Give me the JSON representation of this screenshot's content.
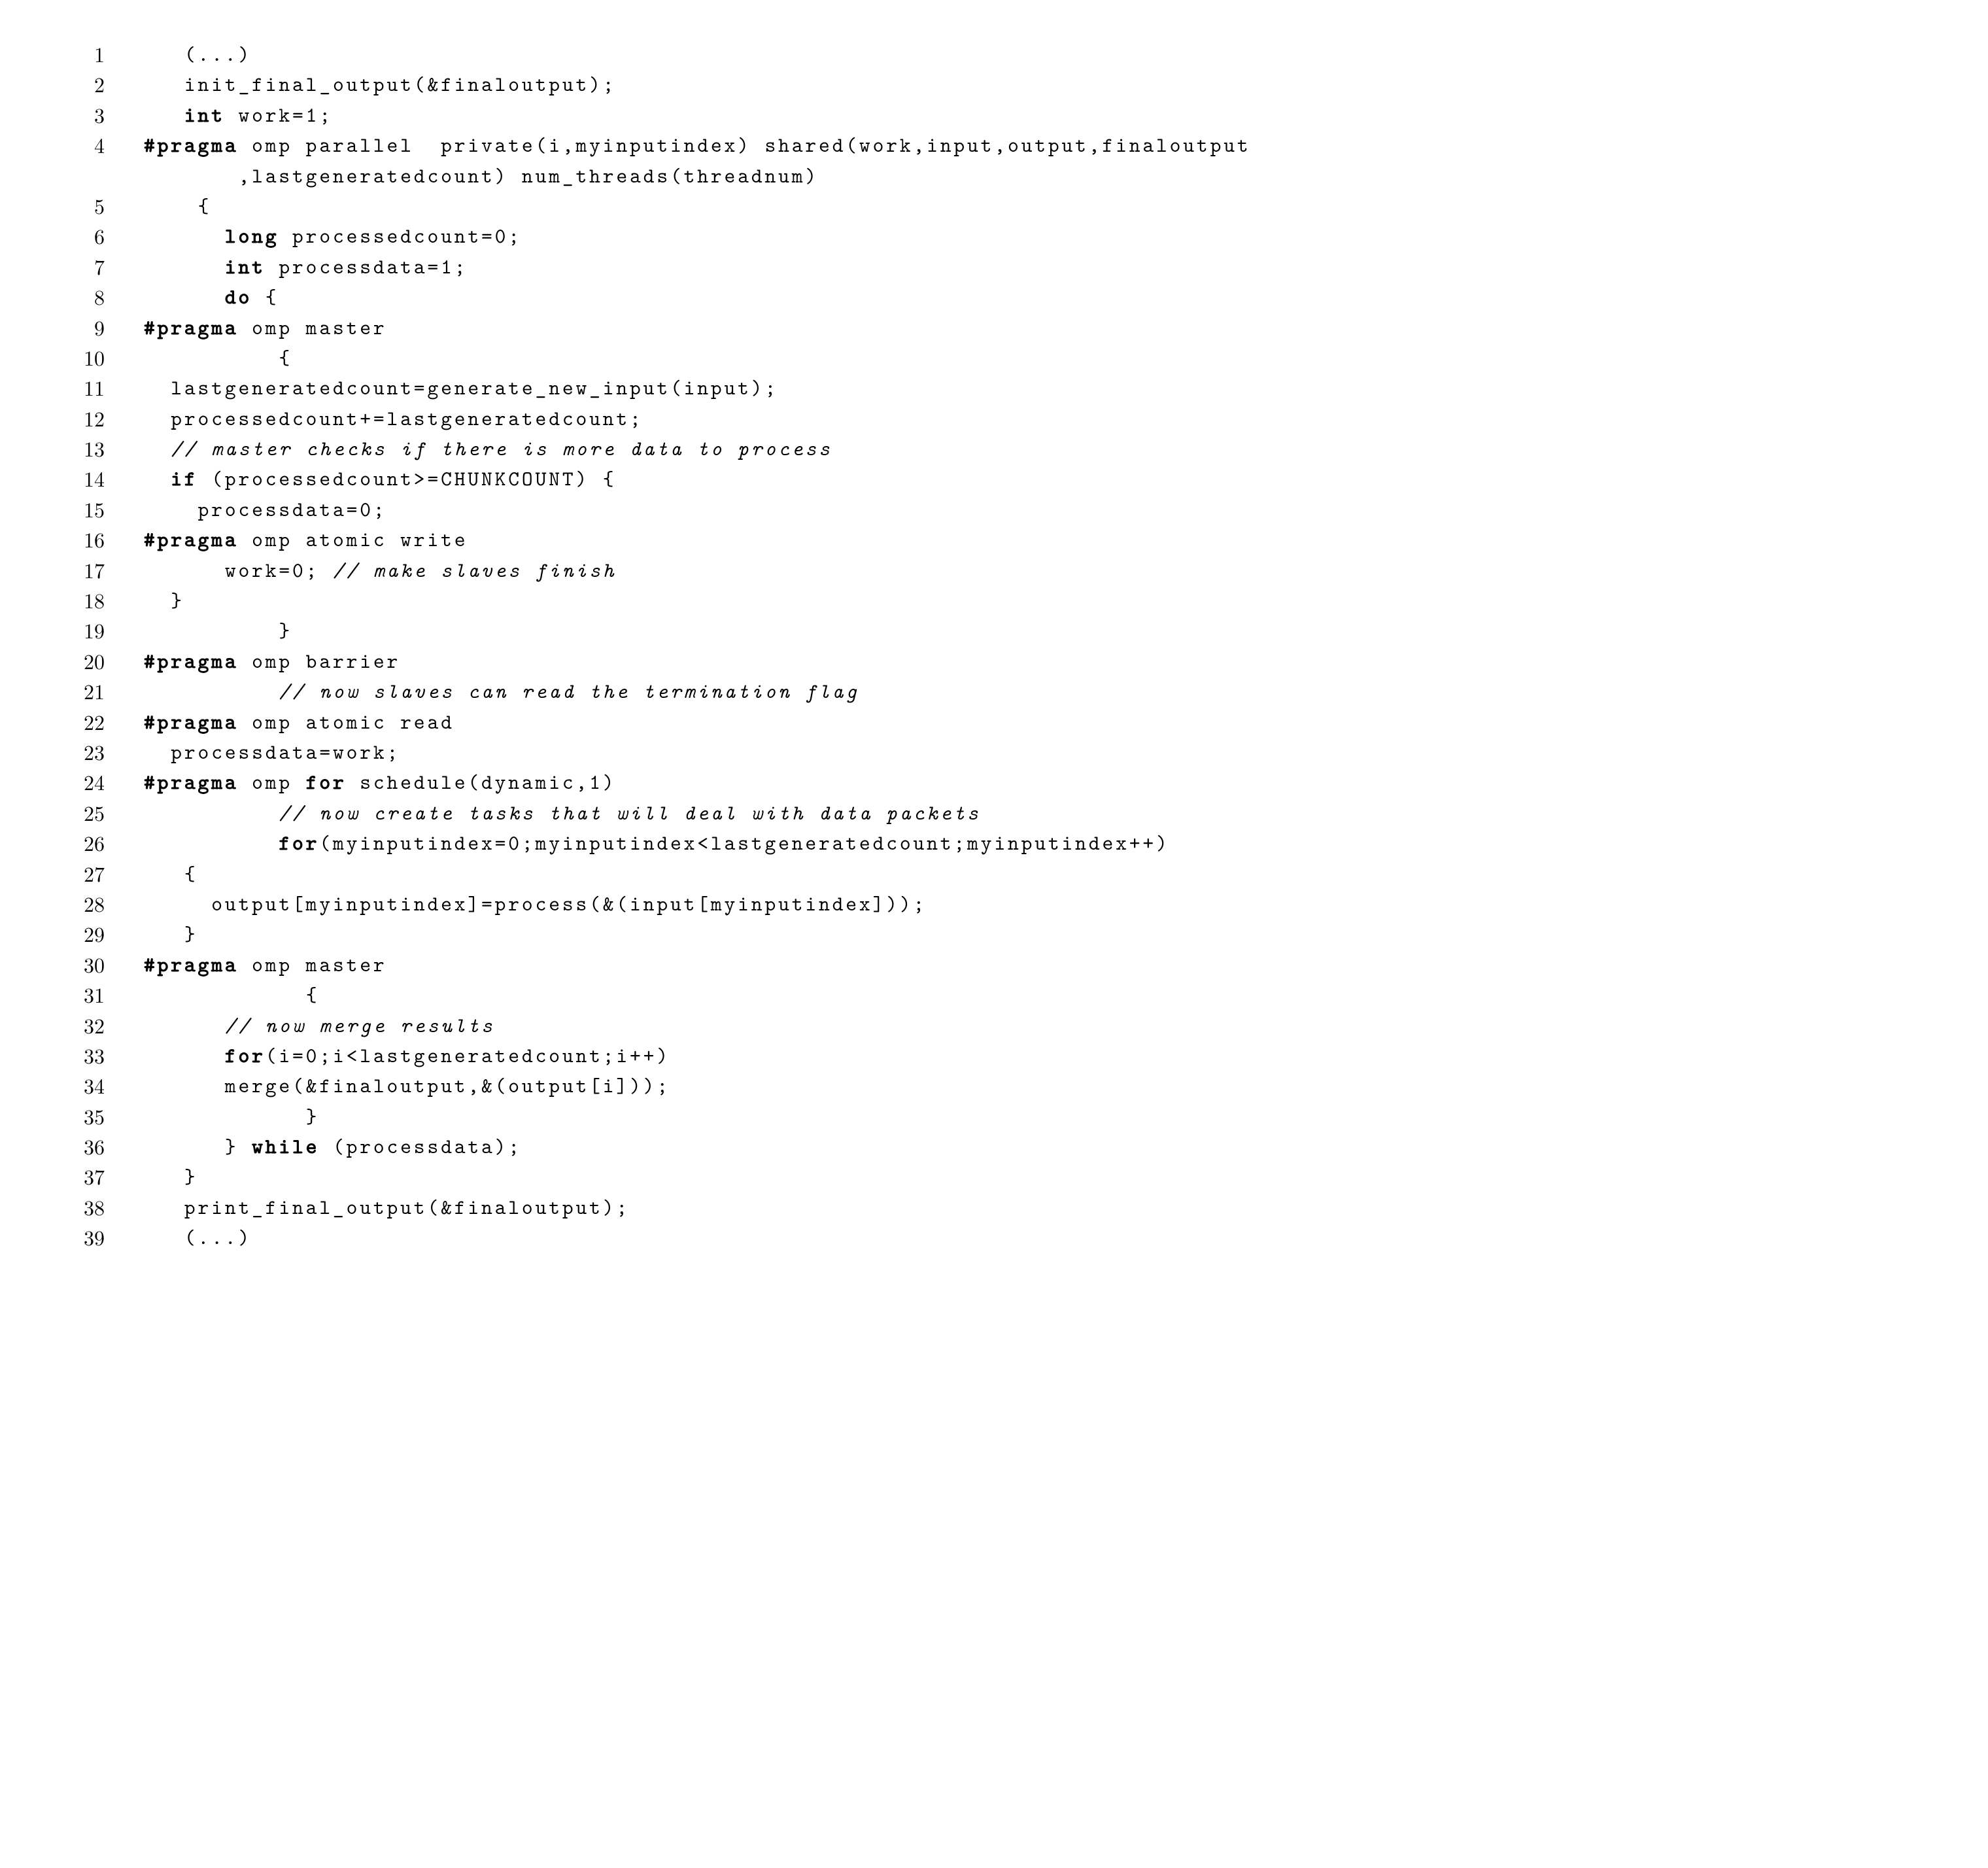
{
  "lines": [
    {
      "n": "1",
      "indent": "   ",
      "segs": [
        {
          "t": "(...)"
        }
      ]
    },
    {
      "n": "2",
      "indent": "   ",
      "segs": [
        {
          "t": "init_final_output(&finaloutput);"
        }
      ]
    },
    {
      "n": "3",
      "indent": "   ",
      "segs": [
        {
          "t": "int",
          "c": "kw"
        },
        {
          "t": " work=1;"
        }
      ]
    },
    {
      "n": "4",
      "indent": "",
      "segs": [
        {
          "t": "#pragma",
          "c": "kw"
        },
        {
          "t": " omp parallel  private(i,myinputindex) shared(work,input,output,finaloutput"
        }
      ]
    },
    {
      "n": "",
      "indent": "       ",
      "segs": [
        {
          "t": ",lastgeneratedcount) num_threads(threadnum)"
        }
      ]
    },
    {
      "n": "5",
      "indent": "    ",
      "segs": [
        {
          "t": "{"
        }
      ]
    },
    {
      "n": "6",
      "indent": "      ",
      "segs": [
        {
          "t": "long",
          "c": "kw"
        },
        {
          "t": " processedcount=0;"
        }
      ]
    },
    {
      "n": "7",
      "indent": "      ",
      "segs": [
        {
          "t": "int",
          "c": "kw"
        },
        {
          "t": " processdata=1;"
        }
      ]
    },
    {
      "n": "8",
      "indent": "      ",
      "segs": [
        {
          "t": "do",
          "c": "kw"
        },
        {
          "t": " {"
        }
      ]
    },
    {
      "n": "9",
      "indent": "",
      "segs": [
        {
          "t": "#pragma",
          "c": "kw"
        },
        {
          "t": " omp master"
        }
      ]
    },
    {
      "n": "10",
      "indent": "          ",
      "segs": [
        {
          "t": "{"
        }
      ]
    },
    {
      "n": "11",
      "indent": "  ",
      "segs": [
        {
          "t": "lastgeneratedcount=generate_new_input(input);"
        }
      ]
    },
    {
      "n": "12",
      "indent": "  ",
      "segs": [
        {
          "t": "processedcount+=lastgeneratedcount;"
        }
      ]
    },
    {
      "n": "13",
      "indent": "  ",
      "segs": [
        {
          "t": "// master checks if there is more data to process",
          "c": "cm"
        }
      ]
    },
    {
      "n": "14",
      "indent": "  ",
      "segs": [
        {
          "t": "if",
          "c": "kw"
        },
        {
          "t": " (processedcount>=CHUNKCOUNT) {"
        }
      ]
    },
    {
      "n": "15",
      "indent": "    ",
      "segs": [
        {
          "t": "processdata=0;"
        }
      ]
    },
    {
      "n": "16",
      "indent": "",
      "segs": [
        {
          "t": "#pragma",
          "c": "kw"
        },
        {
          "t": " omp atomic write"
        }
      ]
    },
    {
      "n": "17",
      "indent": "      ",
      "segs": [
        {
          "t": "work=0; "
        },
        {
          "t": "// make slaves finish",
          "c": "cm"
        }
      ]
    },
    {
      "n": "18",
      "indent": "  ",
      "segs": [
        {
          "t": "}"
        }
      ]
    },
    {
      "n": "19",
      "indent": "          ",
      "segs": [
        {
          "t": "}"
        }
      ]
    },
    {
      "n": "20",
      "indent": "",
      "segs": [
        {
          "t": "#pragma",
          "c": "kw"
        },
        {
          "t": " omp barrier"
        }
      ]
    },
    {
      "n": "21",
      "indent": "          ",
      "segs": [
        {
          "t": "// now slaves can read the termination flag",
          "c": "cm"
        }
      ]
    },
    {
      "n": "22",
      "indent": "",
      "segs": [
        {
          "t": "#pragma",
          "c": "kw"
        },
        {
          "t": " omp atomic read"
        }
      ]
    },
    {
      "n": "23",
      "indent": "  ",
      "segs": [
        {
          "t": "processdata=work;"
        }
      ]
    },
    {
      "n": "24",
      "indent": "",
      "segs": [
        {
          "t": "#pragma",
          "c": "kw"
        },
        {
          "t": " omp "
        },
        {
          "t": "for",
          "c": "kw"
        },
        {
          "t": " schedule(dynamic,1)"
        }
      ]
    },
    {
      "n": "25",
      "indent": "          ",
      "segs": [
        {
          "t": "// now create tasks that will deal with data packets",
          "c": "cm"
        }
      ]
    },
    {
      "n": "26",
      "indent": "          ",
      "segs": [
        {
          "t": "for",
          "c": "kw"
        },
        {
          "t": "(myinputindex=0;myinputindex<lastgeneratedcount;myinputindex++)"
        }
      ]
    },
    {
      "n": "27",
      "indent": "   ",
      "segs": [
        {
          "t": "{"
        }
      ]
    },
    {
      "n": "28",
      "indent": "     ",
      "segs": [
        {
          "t": "output[myinputindex]=process(&(input[myinputindex]));"
        }
      ]
    },
    {
      "n": "29",
      "indent": "   ",
      "segs": [
        {
          "t": "}"
        }
      ]
    },
    {
      "n": "30",
      "indent": "",
      "segs": [
        {
          "t": "#pragma",
          "c": "kw"
        },
        {
          "t": " omp master"
        }
      ]
    },
    {
      "n": "31",
      "indent": "            ",
      "segs": [
        {
          "t": "{"
        }
      ]
    },
    {
      "n": "32",
      "indent": "      ",
      "segs": [
        {
          "t": "// now merge results",
          "c": "cm"
        }
      ]
    },
    {
      "n": "33",
      "indent": "      ",
      "segs": [
        {
          "t": "for",
          "c": "kw"
        },
        {
          "t": "(i=0;i<lastgeneratedcount;i++)"
        }
      ]
    },
    {
      "n": "34",
      "indent": "      ",
      "segs": [
        {
          "t": "merge(&finaloutput,&(output[i]));"
        }
      ]
    },
    {
      "n": "35",
      "indent": "            ",
      "segs": [
        {
          "t": "}"
        }
      ]
    },
    {
      "n": "36",
      "indent": "      ",
      "segs": [
        {
          "t": "} "
        },
        {
          "t": "while",
          "c": "kw"
        },
        {
          "t": " (processdata);"
        }
      ]
    },
    {
      "n": "37",
      "indent": "   ",
      "segs": [
        {
          "t": "}"
        }
      ]
    },
    {
      "n": "38",
      "indent": "   ",
      "segs": [
        {
          "t": "print_final_output(&finaloutput);"
        }
      ]
    },
    {
      "n": "39",
      "indent": "   ",
      "segs": [
        {
          "t": "(...)"
        }
      ]
    }
  ]
}
